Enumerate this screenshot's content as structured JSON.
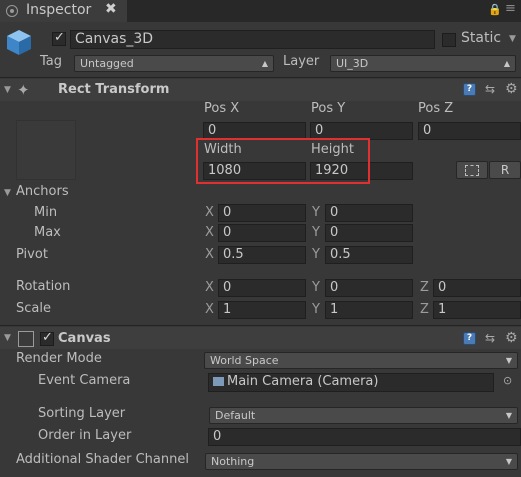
{
  "tab": {
    "title": "Inspector",
    "close": "✖",
    "lock_icon": "lock-icon",
    "menu_icon": "menu-icon"
  },
  "gameobject": {
    "name": "Canvas_3D",
    "active": true,
    "static_label": "Static",
    "tag_label": "Tag",
    "tag_value": "Untagged",
    "layer_label": "Layer",
    "layer_value": "UI_3D"
  },
  "rect_transform": {
    "title": "Rect Transform",
    "pos_x_label": "Pos X",
    "pos_y_label": "Pos Y",
    "pos_z_label": "Pos Z",
    "pos_x": "0",
    "pos_y": "0",
    "pos_z": "0",
    "width_label": "Width",
    "height_label": "Height",
    "width": "1080",
    "height": "1920",
    "r_button": "R",
    "anchors_label": "Anchors",
    "min_label": "Min",
    "min_x": "0",
    "min_y": "0",
    "max_label": "Max",
    "max_x": "0",
    "max_y": "0",
    "pivot_label": "Pivot",
    "pivot_x": "0.5",
    "pivot_y": "0.5",
    "rotation_label": "Rotation",
    "rot_x": "0",
    "rot_y": "0",
    "rot_z": "0",
    "scale_label": "Scale",
    "scale_x": "1",
    "scale_y": "1",
    "scale_z": "1",
    "axis_x": "X",
    "axis_y": "Y",
    "axis_z": "Z"
  },
  "canvas": {
    "title": "Canvas",
    "enabled": true,
    "render_mode_label": "Render Mode",
    "render_mode_value": "World Space",
    "event_camera_label": "Event Camera",
    "event_camera_value": "Main Camera (Camera)",
    "sorting_layer_label": "Sorting Layer",
    "sorting_layer_value": "Default",
    "order_label": "Order in Layer",
    "order_value": "0",
    "shader_label": "Additional Shader Channel",
    "shader_value": "Nothing"
  },
  "colors": {
    "background": "#383838",
    "highlight": "#e03030",
    "help_icon": "#4b7bb5"
  }
}
